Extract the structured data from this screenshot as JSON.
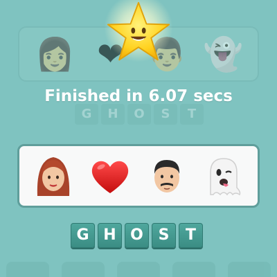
{
  "result": {
    "finished_text": "Finished in 6.07 secs"
  },
  "puzzle": {
    "emojis": [
      "woman-face-emoji",
      "red-heart-emoji",
      "man-face-emoji",
      "ghost-emoji"
    ]
  },
  "answer": {
    "letters": [
      "G",
      "H",
      "O",
      "S",
      "T"
    ]
  },
  "background": {
    "letters": [
      "G",
      "H",
      "O",
      "S",
      "T"
    ]
  },
  "colors": {
    "background": "#7fc3c0",
    "tile": "#3f948a",
    "card": "#f8f9f9",
    "star": "#ffd21f"
  }
}
